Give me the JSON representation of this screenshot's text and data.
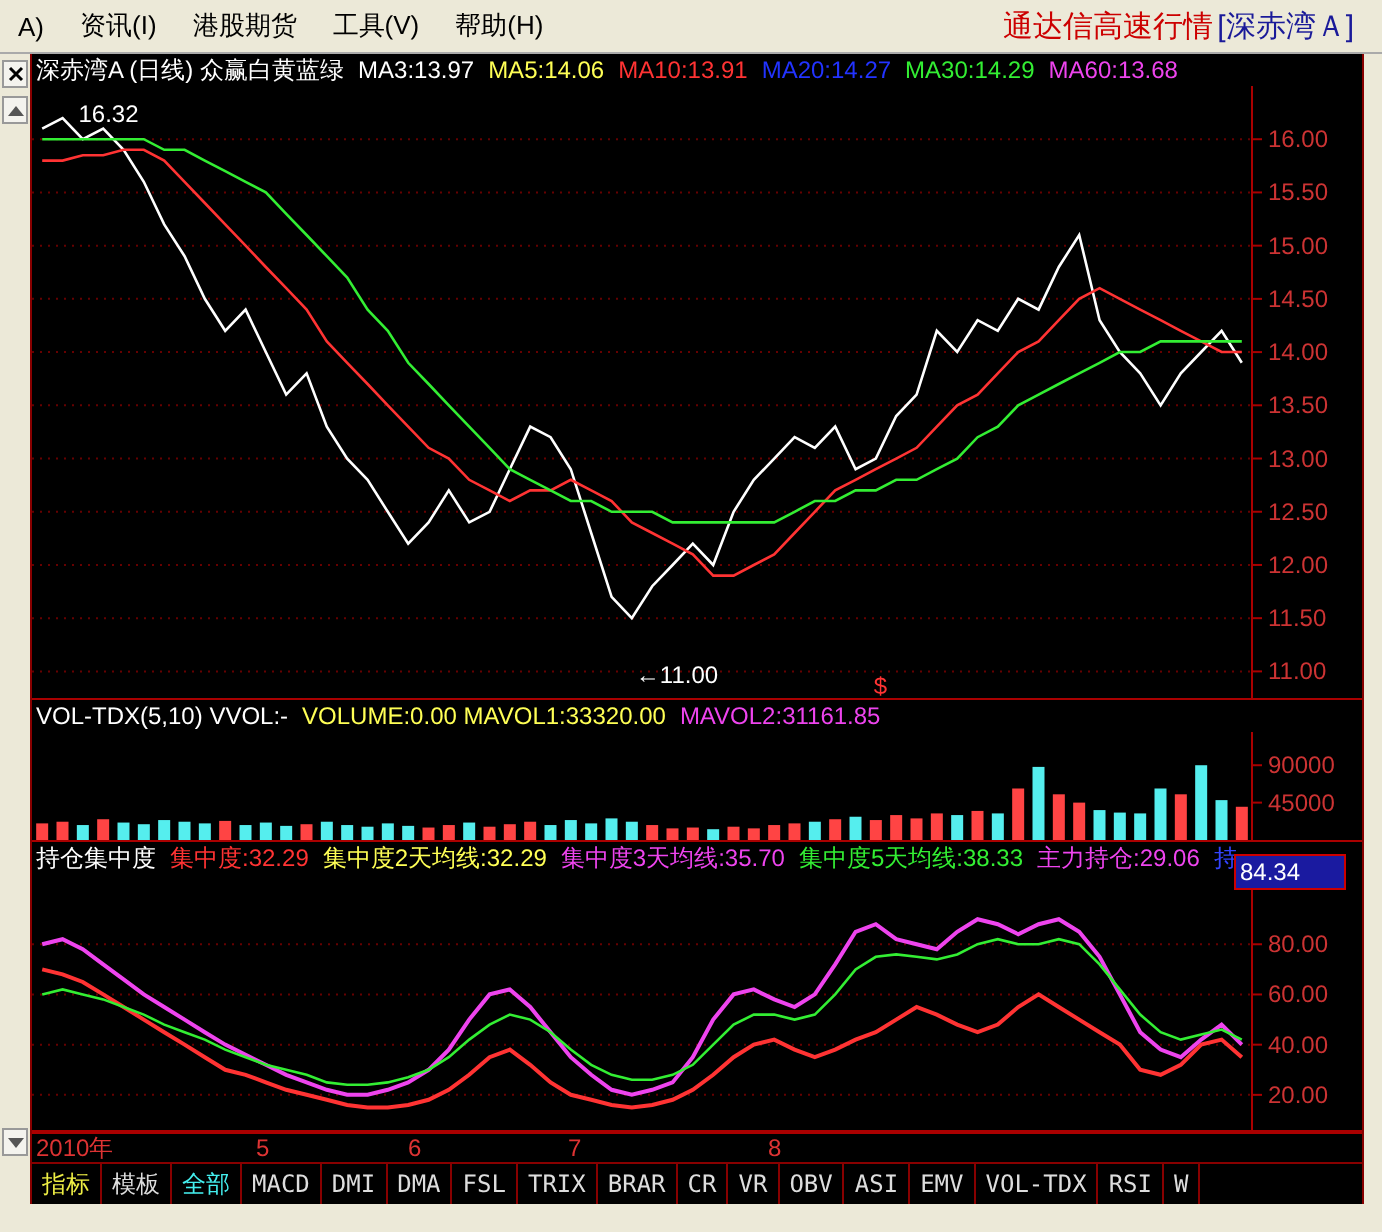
{
  "menu": {
    "items": [
      "A)",
      "资讯(I)",
      "港股期货",
      "工具(V)",
      "帮助(H)"
    ],
    "product": "通达信高速行情",
    "security": "[深赤湾Ａ]"
  },
  "price_panel": {
    "title": "深赤湾A (日线) 众赢白黄蓝绿",
    "legend": [
      {
        "text": "MA3:13.97",
        "color": "#ffffff"
      },
      {
        "text": "MA5:14.06",
        "color": "#ffff55"
      },
      {
        "text": "MA10:13.91",
        "color": "#ff3333"
      },
      {
        "text": "MA20:14.27",
        "color": "#2233ff"
      },
      {
        "text": "MA30:14.29",
        "color": "#33ee33"
      },
      {
        "text": "MA60:13.68",
        "color": "#ee44ee"
      }
    ],
    "high_label": "16.32",
    "low_label": "←11.00",
    "marker": "$",
    "chart_data": {
      "type": "line",
      "grid": true,
      "ylim": [
        10.75,
        16.5
      ],
      "yticks": [
        {
          "value": 16,
          "label": "16.00"
        },
        {
          "value": 15.5,
          "label": "15.50"
        },
        {
          "value": 15,
          "label": "15.00"
        },
        {
          "value": 14.5,
          "label": "14.50"
        },
        {
          "value": 14,
          "label": "14.00"
        },
        {
          "value": 13.5,
          "label": "13.50"
        },
        {
          "value": 13,
          "label": "13.00"
        },
        {
          "value": 12.5,
          "label": "12.50"
        },
        {
          "value": 12,
          "label": "12.00"
        },
        {
          "value": 11.5,
          "label": "11.50"
        },
        {
          "value": 11,
          "label": "11.00"
        }
      ],
      "series": [
        {
          "color": "#ffffff",
          "values": [
            16.1,
            16.2,
            16.0,
            16.1,
            15.9,
            15.6,
            15.2,
            14.9,
            14.5,
            14.2,
            14.4,
            14.0,
            13.6,
            13.8,
            13.3,
            13.0,
            12.8,
            12.5,
            12.2,
            12.4,
            12.7,
            12.4,
            12.5,
            12.9,
            13.3,
            13.2,
            12.9,
            12.3,
            11.7,
            11.5,
            11.8,
            12.0,
            12.2,
            12.0,
            12.5,
            12.8,
            13.0,
            13.2,
            13.1,
            13.3,
            12.9,
            13.0,
            13.4,
            13.6,
            14.2,
            14.0,
            14.3,
            14.2,
            14.5,
            14.4,
            14.8,
            15.1,
            14.3,
            14.0,
            13.8,
            13.5,
            13.8,
            14.0,
            14.2,
            13.9
          ]
        },
        {
          "color": "#ff3333",
          "values": [
            15.8,
            15.8,
            15.85,
            15.85,
            15.9,
            15.9,
            15.8,
            15.6,
            15.4,
            15.2,
            15.0,
            14.8,
            14.6,
            14.4,
            14.1,
            13.9,
            13.7,
            13.5,
            13.3,
            13.1,
            13.0,
            12.8,
            12.7,
            12.6,
            12.7,
            12.7,
            12.8,
            12.7,
            12.6,
            12.4,
            12.3,
            12.2,
            12.1,
            11.9,
            11.9,
            12.0,
            12.1,
            12.3,
            12.5,
            12.7,
            12.8,
            12.9,
            13.0,
            13.1,
            13.3,
            13.5,
            13.6,
            13.8,
            14.0,
            14.1,
            14.3,
            14.5,
            14.6,
            14.5,
            14.4,
            14.3,
            14.2,
            14.1,
            14.0,
            14.0
          ]
        },
        {
          "color": "#33ee33",
          "values": [
            16.0,
            16.0,
            16.0,
            16.0,
            16.0,
            16.0,
            15.9,
            15.9,
            15.8,
            15.7,
            15.6,
            15.5,
            15.3,
            15.1,
            14.9,
            14.7,
            14.4,
            14.2,
            13.9,
            13.7,
            13.5,
            13.3,
            13.1,
            12.9,
            12.8,
            12.7,
            12.6,
            12.6,
            12.5,
            12.5,
            12.5,
            12.4,
            12.4,
            12.4,
            12.4,
            12.4,
            12.4,
            12.5,
            12.6,
            12.6,
            12.7,
            12.7,
            12.8,
            12.8,
            12.9,
            13.0,
            13.2,
            13.3,
            13.5,
            13.6,
            13.7,
            13.8,
            13.9,
            14.0,
            14.0,
            14.1,
            14.1,
            14.1,
            14.1,
            14.1
          ]
        }
      ]
    }
  },
  "volume_panel": {
    "legend": [
      {
        "text": "VOL-TDX(5,10) VVOL:-",
        "color": "#ffffff"
      },
      {
        "text": "VOLUME:0.00 MAVOL1:33320.00",
        "color": "#ffff55"
      },
      {
        "text": "MAVOL2:31161.85",
        "color": "#ee44ee"
      }
    ],
    "chart_data": {
      "type": "bar",
      "ylim": [
        0,
        130000
      ],
      "yticks": [
        {
          "value": 90000,
          "label": "90000"
        },
        {
          "value": 45000,
          "label": "45000"
        }
      ],
      "series": [
        {
          "color": "#ff4444",
          "values": [
            20000,
            22000,
            null,
            25000,
            null,
            null,
            null,
            null,
            null,
            23000,
            null,
            null,
            null,
            19000,
            null,
            null,
            null,
            null,
            null,
            15000,
            18000,
            null,
            16000,
            19000,
            22000,
            null,
            null,
            null,
            null,
            null,
            18000,
            14000,
            15000,
            null,
            16000,
            14000,
            18000,
            20000,
            null,
            25000,
            null,
            24000,
            30000,
            26000,
            32000,
            null,
            35000,
            null,
            62000,
            null,
            55000,
            45000,
            null,
            null,
            null,
            null,
            55000,
            null,
            null,
            40000
          ]
        },
        {
          "color": "#55eeee",
          "values": [
            null,
            null,
            18000,
            null,
            21000,
            19000,
            24000,
            22000,
            20000,
            null,
            18000,
            21000,
            17000,
            null,
            22000,
            18000,
            16000,
            20000,
            17000,
            null,
            null,
            21000,
            null,
            null,
            null,
            18000,
            24000,
            20000,
            26000,
            22000,
            null,
            null,
            null,
            13000,
            null,
            null,
            null,
            null,
            22000,
            null,
            28000,
            null,
            null,
            null,
            null,
            30000,
            null,
            32000,
            null,
            88000,
            null,
            null,
            36000,
            33000,
            32000,
            62000,
            null,
            90000,
            48000,
            null
          ]
        }
      ]
    }
  },
  "indicator_panel": {
    "legend": [
      {
        "text": "持仓集中度",
        "color": "#ffffff"
      },
      {
        "text": "集中度:32.29",
        "color": "#ff3333"
      },
      {
        "text": "集中度2天均线:32.29",
        "color": "#ffff55"
      },
      {
        "text": "集中度3天均线:35.70",
        "color": "#ee44ee"
      },
      {
        "text": "集中度5天均线:38.33",
        "color": "#33ee33"
      },
      {
        "text": "主力持仓:29.06",
        "color": "#ee44ee"
      },
      {
        "text": "持",
        "color": "#3344ff"
      }
    ],
    "current_value": "84.34",
    "chart_data": {
      "type": "line",
      "grid": true,
      "ylim": [
        6,
        108
      ],
      "yticks": [
        {
          "value": 80,
          "label": "80.00"
        },
        {
          "value": 60,
          "label": "60.00"
        },
        {
          "value": 40,
          "label": "40.00"
        },
        {
          "value": 20,
          "label": "20.00"
        }
      ],
      "series": [
        {
          "color": "#ff3333",
          "values": [
            70,
            68,
            65,
            60,
            55,
            50,
            45,
            40,
            35,
            30,
            28,
            25,
            22,
            20,
            18,
            16,
            15,
            15,
            16,
            18,
            22,
            28,
            35,
            38,
            32,
            25,
            20,
            18,
            16,
            15,
            16,
            18,
            22,
            28,
            35,
            40,
            42,
            38,
            35,
            38,
            42,
            45,
            50,
            55,
            52,
            48,
            45,
            48,
            55,
            60,
            55,
            50,
            45,
            40,
            30,
            28,
            32,
            40,
            42,
            35
          ]
        },
        {
          "color": "#ee44ee",
          "values": [
            80,
            82,
            78,
            72,
            66,
            60,
            55,
            50,
            45,
            40,
            36,
            32,
            28,
            25,
            22,
            20,
            20,
            22,
            25,
            30,
            38,
            50,
            60,
            62,
            55,
            45,
            35,
            28,
            22,
            20,
            22,
            25,
            35,
            50,
            60,
            62,
            58,
            55,
            60,
            72,
            85,
            88,
            82,
            80,
            78,
            85,
            90,
            88,
            84,
            88,
            90,
            85,
            75,
            60,
            45,
            38,
            35,
            42,
            48,
            40
          ]
        },
        {
          "color": "#33ee33",
          "values": [
            60,
            62,
            60,
            58,
            55,
            52,
            48,
            45,
            42,
            38,
            35,
            32,
            30,
            28,
            25,
            24,
            24,
            25,
            27,
            30,
            35,
            42,
            48,
            52,
            50,
            45,
            38,
            32,
            28,
            26,
            26,
            28,
            32,
            40,
            48,
            52,
            52,
            50,
            52,
            60,
            70,
            75,
            76,
            75,
            74,
            76,
            80,
            82,
            80,
            80,
            82,
            80,
            72,
            62,
            52,
            45,
            42,
            44,
            46,
            42
          ]
        }
      ]
    }
  },
  "date_axis": [
    "2010年",
    "5",
    "6",
    "7",
    "8"
  ],
  "tabs": [
    {
      "label": "指标",
      "kind": "mode",
      "selected": true
    },
    {
      "label": "模板",
      "kind": "mode",
      "selected": false
    },
    {
      "label": "全部",
      "kind": "filter",
      "selected": true
    },
    {
      "label": "MACD",
      "kind": "formula",
      "selected": false
    },
    {
      "label": "DMI",
      "kind": "formula",
      "selected": false
    },
    {
      "label": "DMA",
      "kind": "formula",
      "selected": false
    },
    {
      "label": "FSL",
      "kind": "formula",
      "selected": false
    },
    {
      "label": "TRIX",
      "kind": "formula",
      "selected": false
    },
    {
      "label": "BRAR",
      "kind": "formula",
      "selected": false
    },
    {
      "label": "CR",
      "kind": "formula",
      "selected": false
    },
    {
      "label": "VR",
      "kind": "formula",
      "selected": false
    },
    {
      "label": "OBV",
      "kind": "formula",
      "selected": false
    },
    {
      "label": "ASI",
      "kind": "formula",
      "selected": false
    },
    {
      "label": "EMV",
      "kind": "formula",
      "selected": false
    },
    {
      "label": "VOL-TDX",
      "kind": "formula",
      "selected": false
    },
    {
      "label": "RSI",
      "kind": "formula",
      "selected": false
    },
    {
      "label": "W",
      "kind": "formula",
      "selected": false
    }
  ]
}
